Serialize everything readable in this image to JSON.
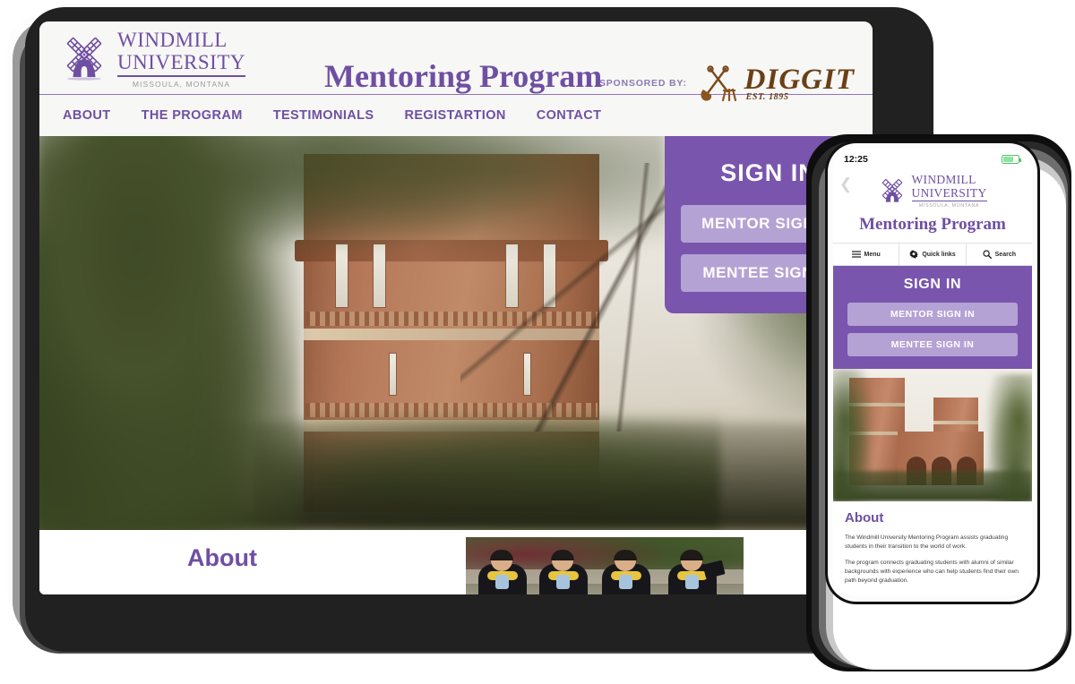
{
  "colors": {
    "purple": "#6f4fa3",
    "panel_purple": "#7a55ad",
    "button_lavender": "#b5a2d4",
    "header_bg": "#f7f7f5",
    "sponsor_brown": "#6b3f16",
    "battery_green": "#4cc264"
  },
  "desktop": {
    "brand": {
      "logo_icon": "windmill-icon",
      "name_line1": "WINDMILL",
      "name_line2": "UNIVERSITY",
      "location": "MISSOULA, MONTANA"
    },
    "site_title": "Mentoring Program",
    "sponsor": {
      "label": "SPONSORED BY:",
      "logo_icon": "shovel-pitchfork-icon",
      "name": "DIGGIT",
      "established": "EST. 1895"
    },
    "nav": [
      {
        "label": "ABOUT",
        "name": "nav-about"
      },
      {
        "label": "THE PROGRAM",
        "name": "nav-the-program"
      },
      {
        "label": "TESTIMONIALS",
        "name": "nav-testimonials"
      },
      {
        "label": "REGISTARTION",
        "name": "nav-registartion"
      },
      {
        "label": "CONTACT",
        "name": "nav-contact"
      }
    ],
    "hero": {
      "image_alt": "university-brick-tower-photo"
    },
    "signin": {
      "title": "SIGN IN",
      "mentor_button": "MENTOR SIGN IN",
      "mentee_button": "MENTEE SIGN IN"
    },
    "about": {
      "heading": "About",
      "image_alt": "graduating-students-photo"
    }
  },
  "phone": {
    "status": {
      "time": "12:25",
      "battery_icon": "battery-icon",
      "back_icon": "chevron-left-icon"
    },
    "brand": {
      "logo_icon": "windmill-icon",
      "name_line1": "WINDMILL",
      "name_line2": "UNIVERSITY",
      "location": "MISSOULA, MONTANA"
    },
    "site_title": "Mentoring Program",
    "toolbar": [
      {
        "label": "Menu",
        "icon": "hamburger-icon",
        "name": "phone-tool-menu"
      },
      {
        "label": "Quick links",
        "icon": "gear-icon",
        "name": "phone-tool-quick-links"
      },
      {
        "label": "Search",
        "icon": "search-icon",
        "name": "phone-tool-search"
      }
    ],
    "signin": {
      "title": "SIGN IN",
      "mentor_button": "MENTOR SIGN IN",
      "mentee_button": "MENTEE SIGN IN"
    },
    "hero": {
      "image_alt": "university-building-photo"
    },
    "about": {
      "heading": "About",
      "paragraph1": "The Windmill University Mentoring Program assists graduating students in their transition to the world of work.",
      "paragraph2": "The program connects graduating students with alumni of similar backgrounds with experience who can help students find their own path beyond graduation."
    }
  }
}
